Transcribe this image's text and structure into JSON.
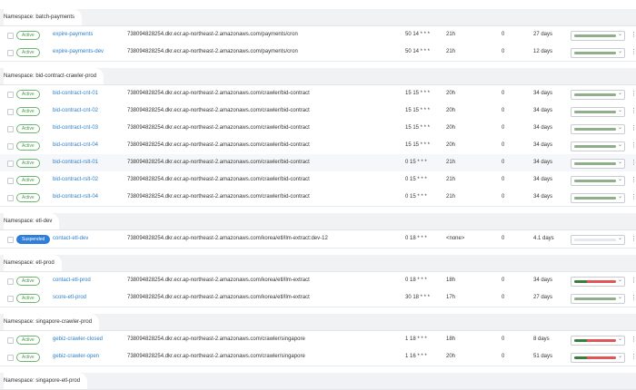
{
  "colors": {
    "green": "#8fae8a",
    "red": "#e05555",
    "dark_green": "#3a7d3d",
    "empty": "#e6e8f0"
  },
  "namespaces": [
    {
      "label": "Namespace: batch-payments",
      "rows": [
        {
          "status": "Active",
          "name": "expire-payments",
          "image": "738094828254.dkr.ecr.ap-northeast-2.amazonaws.com/payments/cron",
          "schedule": "50 14 * * *",
          "last": "21h",
          "active": "0",
          "age": "27 days",
          "bar": "green"
        },
        {
          "status": "Active",
          "name": "expire-payments-dev",
          "image": "738094828254.dkr.ecr.ap-northeast-2.amazonaws.com/payments/cron",
          "schedule": "50 14 * * *",
          "last": "21h",
          "active": "0",
          "age": "12 days",
          "bar": "green"
        }
      ]
    },
    {
      "label": "Namespace: bid-contract-crawler-prod",
      "rows": [
        {
          "status": "Active",
          "name": "bid-contract-cnt-01",
          "image": "738094828254.dkr.ecr.ap-northeast-2.amazonaws.com/crawler/bid-contract",
          "schedule": "15 15 * * *",
          "last": "20h",
          "active": "0",
          "age": "34 days",
          "bar": "green"
        },
        {
          "status": "Active",
          "name": "bid-contract-cnt-02",
          "image": "738094828254.dkr.ecr.ap-northeast-2.amazonaws.com/crawler/bid-contract",
          "schedule": "15 15 * * *",
          "last": "20h",
          "active": "0",
          "age": "34 days",
          "bar": "green"
        },
        {
          "status": "Active",
          "name": "bid-contract-cnt-03",
          "image": "738094828254.dkr.ecr.ap-northeast-2.amazonaws.com/crawler/bid-contract",
          "schedule": "15 15 * * *",
          "last": "20h",
          "active": "0",
          "age": "34 days",
          "bar": "green"
        },
        {
          "status": "Active",
          "name": "bid-contract-cnt-04",
          "image": "738094828254.dkr.ecr.ap-northeast-2.amazonaws.com/crawler/bid-contract",
          "schedule": "15 15 * * *",
          "last": "20h",
          "active": "0",
          "age": "34 days",
          "bar": "green"
        },
        {
          "status": "Active",
          "name": "bid-contract-rslt-01",
          "image": "738094828254.dkr.ecr.ap-northeast-2.amazonaws.com/crawler/bid-contract",
          "schedule": "0 15 * * *",
          "last": "21h",
          "active": "0",
          "age": "34 days",
          "bar": "green",
          "highlight": true
        },
        {
          "status": "Active",
          "name": "bid-contract-rslt-02",
          "image": "738094828254.dkr.ecr.ap-northeast-2.amazonaws.com/crawler/bid-contract",
          "schedule": "0 15 * * *",
          "last": "21h",
          "active": "0",
          "age": "34 days",
          "bar": "green"
        },
        {
          "status": "Active",
          "name": "bid-contract-rslt-04",
          "image": "738094828254.dkr.ecr.ap-northeast-2.amazonaws.com/crawler/bid-contract",
          "schedule": "0 15 * * *",
          "last": "21h",
          "active": "0",
          "age": "34 days",
          "bar": "green"
        }
      ]
    },
    {
      "label": "Namespace: etl-dev",
      "rows": [
        {
          "status": "Suspended",
          "name": "contact-etl-dev",
          "image": "738094828254.dkr.ecr.ap-northeast-2.amazonaws.com/korea/etl/llm-extract:dev-12",
          "schedule": "0 18 * * *",
          "last": "<none>",
          "active": "0",
          "age": "4.1 days",
          "bar": "empty"
        }
      ]
    },
    {
      "label": "Namespace: etl-prod",
      "rows": [
        {
          "status": "Active",
          "name": "contact-etl-prod",
          "image": "738094828254.dkr.ecr.ap-northeast-2.amazonaws.com/korea/etl/llm-extract",
          "schedule": "0 18 * * *",
          "last": "18h",
          "active": "0",
          "age": "34 days",
          "bar": "mixed"
        },
        {
          "status": "Active",
          "name": "score-etl-prod",
          "image": "738094828254.dkr.ecr.ap-northeast-2.amazonaws.com/korea/etl/llm-extract",
          "schedule": "30 18 * * *",
          "last": "17h",
          "active": "0",
          "age": "27 days",
          "bar": "green"
        }
      ]
    },
    {
      "label": "Namespace: singapore-crawler-prod",
      "rows": [
        {
          "status": "Active",
          "name": "gebiz-crawler-closed",
          "image": "738094828254.dkr.ecr.ap-northeast-2.amazonaws.com/crawler/singapore",
          "schedule": "1 18 * * *",
          "last": "18h",
          "active": "0",
          "age": "8 days",
          "bar": "mixed"
        },
        {
          "status": "Active",
          "name": "gebiz-crawler-open",
          "image": "738094828254.dkr.ecr.ap-northeast-2.amazonaws.com/crawler/singapore",
          "schedule": "1 16 * * *",
          "last": "20h",
          "active": "0",
          "age": "51 days",
          "bar": "mixed"
        }
      ]
    },
    {
      "label": "Namespace: singapore-etl-prod",
      "rows": []
    }
  ]
}
